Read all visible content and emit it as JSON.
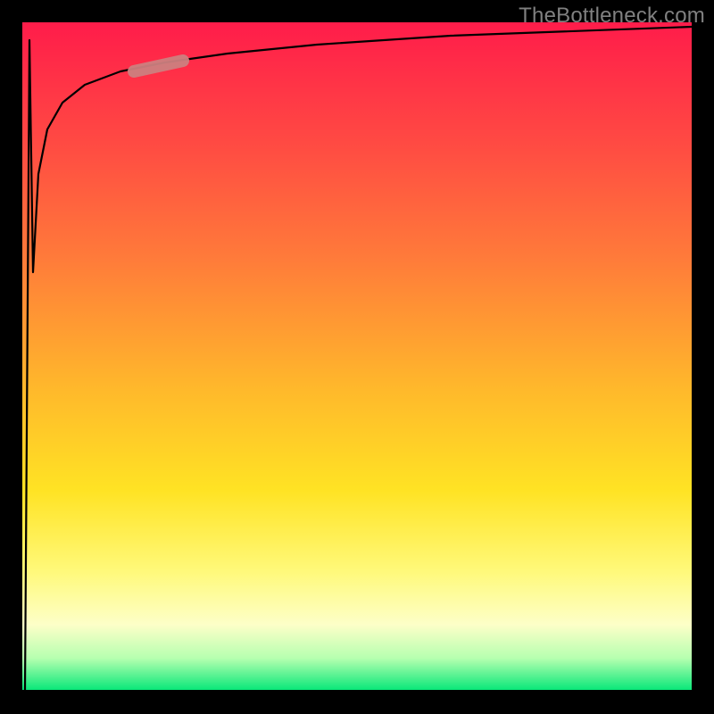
{
  "watermark": "TheBottleneck.com",
  "colors": {
    "watermark": "#808080",
    "curve": "#000000",
    "highlight_fill": "#cc8080",
    "highlight_stroke": "#b86f6f",
    "gradient": [
      "#ff1c4a",
      "#ff4a43",
      "#ff7a3a",
      "#ffb92b",
      "#ffe324",
      "#fff97a",
      "#fdffc8",
      "#b6ffb0",
      "#00e676"
    ]
  },
  "chart_data": {
    "type": "line",
    "x": [
      0.0,
      0.01,
      0.02,
      0.03,
      0.05,
      0.08,
      0.12,
      0.18,
      0.25,
      0.35,
      0.5,
      0.7,
      1.0
    ],
    "y": [
      0.0,
      0.97,
      0.62,
      0.78,
      0.86,
      0.9,
      0.925,
      0.945,
      0.96,
      0.97,
      0.98,
      0.987,
      0.995
    ],
    "xlabel": "",
    "ylabel": "",
    "xlim": [
      0,
      1
    ],
    "ylim": [
      0,
      1
    ],
    "title": "",
    "highlight_segment": {
      "x_start": 0.17,
      "x_end": 0.24,
      "y_start": 0.925,
      "y_end": 0.945
    },
    "notes": "Curve starts at origin, spikes nearly to top at very small x, dips, then asymptotically approaches ~1.0. Background is a red→green vertical gradient. Axes are unlabeled."
  }
}
